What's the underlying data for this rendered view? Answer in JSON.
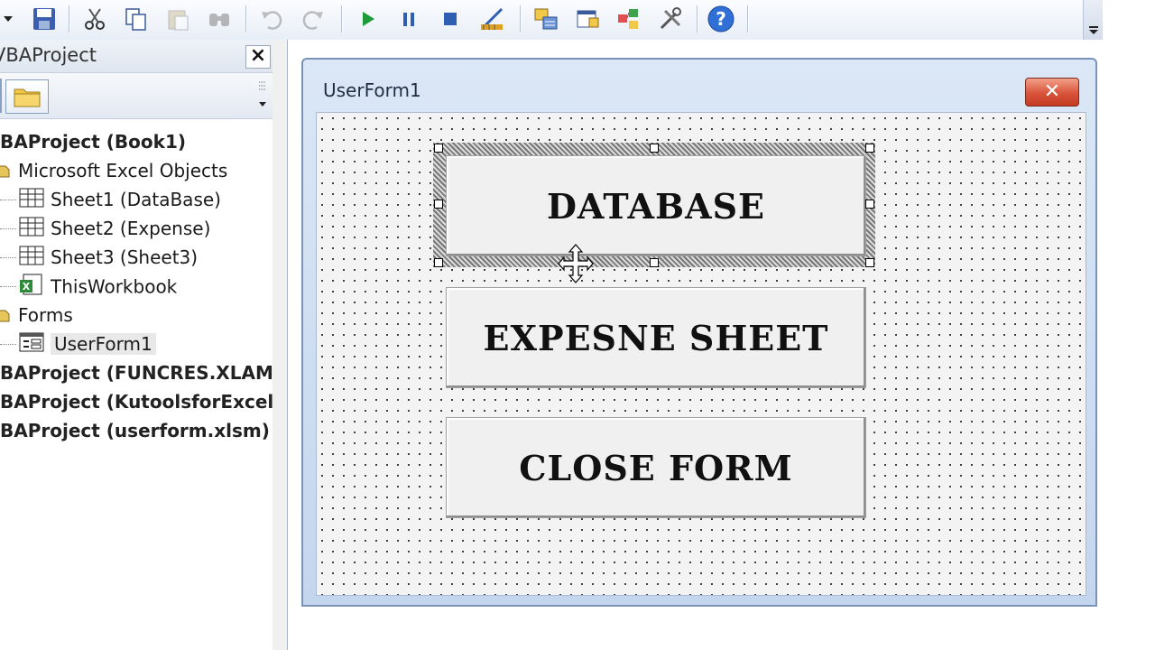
{
  "project": {
    "title": "VBAProject",
    "tree": [
      {
        "label": "BAProject (Book1)",
        "bold": true
      },
      {
        "label": "Microsoft Excel Objects"
      },
      {
        "label": "Sheet1 (DataBase)"
      },
      {
        "label": "Sheet2 (Expense)"
      },
      {
        "label": "Sheet3 (Sheet3)"
      },
      {
        "label": "ThisWorkbook"
      },
      {
        "label": "Forms"
      },
      {
        "label": "UserForm1"
      },
      {
        "label": "BAProject (FUNCRES.XLAM)",
        "bold": true
      },
      {
        "label": "BAProject (KutoolsforExcel",
        "bold": true
      },
      {
        "label": "BAProject (userform.xlsm)",
        "bold": true
      }
    ]
  },
  "userform": {
    "title": "UserForm1",
    "buttons": [
      "DATABASE",
      "EXPESNE SHEET",
      "CLOSE FORM"
    ]
  },
  "colors": {
    "accent_blue": "#2f6fd6",
    "close_red": "#d8543a"
  }
}
